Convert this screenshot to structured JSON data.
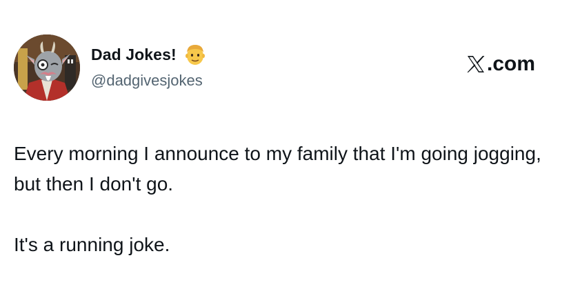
{
  "author": {
    "display_name": "Dad Jokes!",
    "handle": "@dadgivesjokes",
    "badge_icon": "man-emoji-icon",
    "avatar_icon": "cartoon-goat-avatar"
  },
  "brand": {
    "label": ".com",
    "logo_icon": "x-logo-icon"
  },
  "tweet": {
    "paragraph_1": "Every morning I announce to my family that I'm going jogging, but then I don't go.",
    "paragraph_2": "It's a running joke."
  },
  "colors": {
    "text": "#0f1419",
    "secondary_text": "#536471",
    "background": "#ffffff"
  }
}
